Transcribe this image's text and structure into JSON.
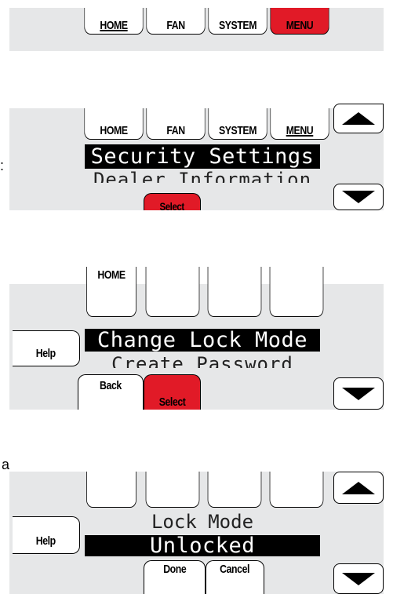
{
  "colors": {
    "panel": "#e6e7e8",
    "accent_red": "#e11a27",
    "lcd_highlight": "#000000"
  },
  "step1": {
    "home": "HOME",
    "fan": "FAN",
    "system": "SYSTEM",
    "menu": "MENU"
  },
  "step2": {
    "home": "HOME",
    "fan": "FAN",
    "system": "SYSTEM",
    "menu": "MENU",
    "highlighted": "Security Settings",
    "next": "Dealer Information",
    "select": "Select",
    "up_icon": "up-arrow-icon",
    "down_icon": "down-arrow-icon",
    "edge_text": ":"
  },
  "step3": {
    "home": "HOME",
    "help": "Help",
    "highlighted": "Change Lock Mode",
    "next": "Create Password",
    "back": "Back",
    "select": "Select",
    "down_icon": "down-arrow-icon"
  },
  "step4": {
    "help": "Help",
    "title": "Lock Mode",
    "highlighted": "Unlocked",
    "done": "Done",
    "cancel": "Cancel",
    "up_icon": "up-arrow-icon",
    "down_icon": "down-arrow-icon",
    "edge_text": "a"
  }
}
